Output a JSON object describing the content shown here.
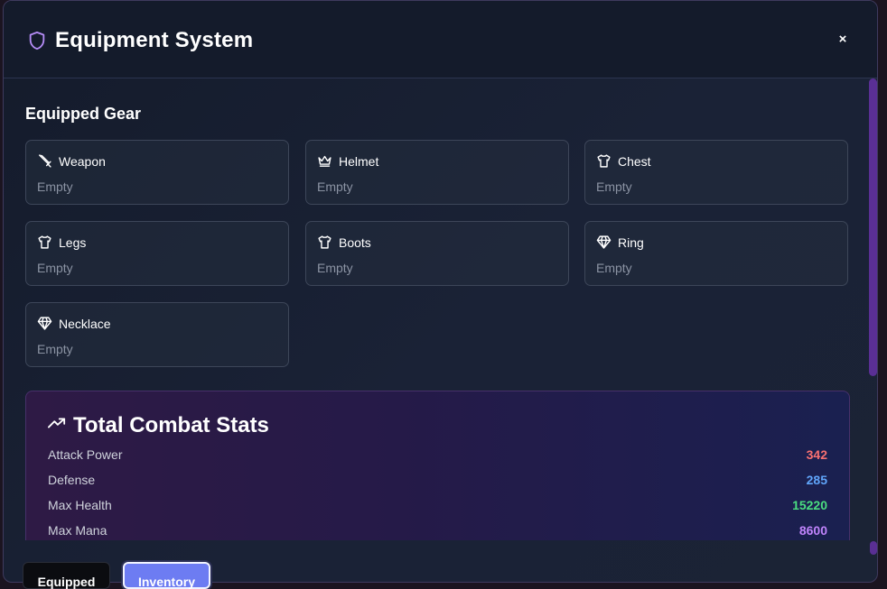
{
  "header": {
    "title": "Equipment System",
    "icon": "shield-icon",
    "close_label": "×"
  },
  "equipped": {
    "title": "Equipped Gear",
    "slots": [
      {
        "name": "Weapon",
        "value": "Empty",
        "icon": "sword-icon"
      },
      {
        "name": "Helmet",
        "value": "Empty",
        "icon": "crown-icon"
      },
      {
        "name": "Chest",
        "value": "Empty",
        "icon": "shirt-icon"
      },
      {
        "name": "Legs",
        "value": "Empty",
        "icon": "shirt-icon"
      },
      {
        "name": "Boots",
        "value": "Empty",
        "icon": "shirt-icon"
      },
      {
        "name": "Ring",
        "value": "Empty",
        "icon": "gem-icon"
      },
      {
        "name": "Necklace",
        "value": "Empty",
        "icon": "gem-icon"
      }
    ]
  },
  "stats": {
    "title": "Total Combat Stats",
    "icon": "trending-up-icon",
    "rows": [
      {
        "label": "Attack Power",
        "value": "342",
        "color": "#f87171"
      },
      {
        "label": "Defense",
        "value": "285",
        "color": "#60a5fa"
      },
      {
        "label": "Max Health",
        "value": "15220",
        "color": "#4ade80"
      },
      {
        "label": "Max Mana",
        "value": "8600",
        "color": "#c084fc"
      }
    ]
  },
  "tabs": {
    "equipped_label": "Equipped",
    "inventory_label": "Inventory",
    "active": "Inventory"
  },
  "colors": {
    "accent": "#6d7cf2",
    "shield": "#b58cf7",
    "scrollbar": "#5a2f94"
  }
}
